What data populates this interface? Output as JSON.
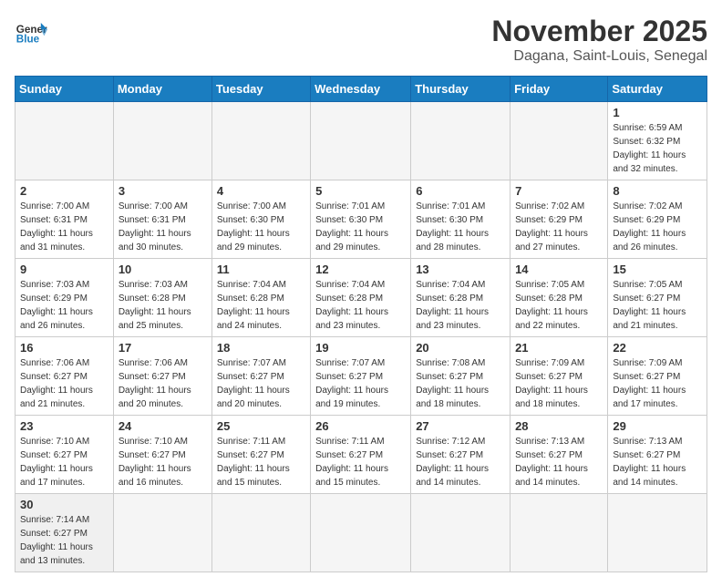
{
  "header": {
    "logo_general": "General",
    "logo_blue": "Blue",
    "month_title": "November 2025",
    "subtitle": "Dagana, Saint-Louis, Senegal"
  },
  "weekdays": [
    "Sunday",
    "Monday",
    "Tuesday",
    "Wednesday",
    "Thursday",
    "Friday",
    "Saturday"
  ],
  "weeks": [
    [
      {
        "day": "",
        "info": ""
      },
      {
        "day": "",
        "info": ""
      },
      {
        "day": "",
        "info": ""
      },
      {
        "day": "",
        "info": ""
      },
      {
        "day": "",
        "info": ""
      },
      {
        "day": "",
        "info": ""
      },
      {
        "day": "1",
        "info": "Sunrise: 6:59 AM\nSunset: 6:32 PM\nDaylight: 11 hours\nand 32 minutes."
      }
    ],
    [
      {
        "day": "2",
        "info": "Sunrise: 7:00 AM\nSunset: 6:31 PM\nDaylight: 11 hours\nand 31 minutes."
      },
      {
        "day": "3",
        "info": "Sunrise: 7:00 AM\nSunset: 6:31 PM\nDaylight: 11 hours\nand 30 minutes."
      },
      {
        "day": "4",
        "info": "Sunrise: 7:00 AM\nSunset: 6:30 PM\nDaylight: 11 hours\nand 29 minutes."
      },
      {
        "day": "5",
        "info": "Sunrise: 7:01 AM\nSunset: 6:30 PM\nDaylight: 11 hours\nand 29 minutes."
      },
      {
        "day": "6",
        "info": "Sunrise: 7:01 AM\nSunset: 6:30 PM\nDaylight: 11 hours\nand 28 minutes."
      },
      {
        "day": "7",
        "info": "Sunrise: 7:02 AM\nSunset: 6:29 PM\nDaylight: 11 hours\nand 27 minutes."
      },
      {
        "day": "8",
        "info": "Sunrise: 7:02 AM\nSunset: 6:29 PM\nDaylight: 11 hours\nand 26 minutes."
      }
    ],
    [
      {
        "day": "9",
        "info": "Sunrise: 7:03 AM\nSunset: 6:29 PM\nDaylight: 11 hours\nand 26 minutes."
      },
      {
        "day": "10",
        "info": "Sunrise: 7:03 AM\nSunset: 6:28 PM\nDaylight: 11 hours\nand 25 minutes."
      },
      {
        "day": "11",
        "info": "Sunrise: 7:04 AM\nSunset: 6:28 PM\nDaylight: 11 hours\nand 24 minutes."
      },
      {
        "day": "12",
        "info": "Sunrise: 7:04 AM\nSunset: 6:28 PM\nDaylight: 11 hours\nand 23 minutes."
      },
      {
        "day": "13",
        "info": "Sunrise: 7:04 AM\nSunset: 6:28 PM\nDaylight: 11 hours\nand 23 minutes."
      },
      {
        "day": "14",
        "info": "Sunrise: 7:05 AM\nSunset: 6:28 PM\nDaylight: 11 hours\nand 22 minutes."
      },
      {
        "day": "15",
        "info": "Sunrise: 7:05 AM\nSunset: 6:27 PM\nDaylight: 11 hours\nand 21 minutes."
      }
    ],
    [
      {
        "day": "16",
        "info": "Sunrise: 7:06 AM\nSunset: 6:27 PM\nDaylight: 11 hours\nand 21 minutes."
      },
      {
        "day": "17",
        "info": "Sunrise: 7:06 AM\nSunset: 6:27 PM\nDaylight: 11 hours\nand 20 minutes."
      },
      {
        "day": "18",
        "info": "Sunrise: 7:07 AM\nSunset: 6:27 PM\nDaylight: 11 hours\nand 20 minutes."
      },
      {
        "day": "19",
        "info": "Sunrise: 7:07 AM\nSunset: 6:27 PM\nDaylight: 11 hours\nand 19 minutes."
      },
      {
        "day": "20",
        "info": "Sunrise: 7:08 AM\nSunset: 6:27 PM\nDaylight: 11 hours\nand 18 minutes."
      },
      {
        "day": "21",
        "info": "Sunrise: 7:09 AM\nSunset: 6:27 PM\nDaylight: 11 hours\nand 18 minutes."
      },
      {
        "day": "22",
        "info": "Sunrise: 7:09 AM\nSunset: 6:27 PM\nDaylight: 11 hours\nand 17 minutes."
      }
    ],
    [
      {
        "day": "23",
        "info": "Sunrise: 7:10 AM\nSunset: 6:27 PM\nDaylight: 11 hours\nand 17 minutes."
      },
      {
        "day": "24",
        "info": "Sunrise: 7:10 AM\nSunset: 6:27 PM\nDaylight: 11 hours\nand 16 minutes."
      },
      {
        "day": "25",
        "info": "Sunrise: 7:11 AM\nSunset: 6:27 PM\nDaylight: 11 hours\nand 15 minutes."
      },
      {
        "day": "26",
        "info": "Sunrise: 7:11 AM\nSunset: 6:27 PM\nDaylight: 11 hours\nand 15 minutes."
      },
      {
        "day": "27",
        "info": "Sunrise: 7:12 AM\nSunset: 6:27 PM\nDaylight: 11 hours\nand 14 minutes."
      },
      {
        "day": "28",
        "info": "Sunrise: 7:13 AM\nSunset: 6:27 PM\nDaylight: 11 hours\nand 14 minutes."
      },
      {
        "day": "29",
        "info": "Sunrise: 7:13 AM\nSunset: 6:27 PM\nDaylight: 11 hours\nand 14 minutes."
      }
    ],
    [
      {
        "day": "30",
        "info": "Sunrise: 7:14 AM\nSunset: 6:27 PM\nDaylight: 11 hours\nand 13 minutes."
      },
      {
        "day": "",
        "info": ""
      },
      {
        "day": "",
        "info": ""
      },
      {
        "day": "",
        "info": ""
      },
      {
        "day": "",
        "info": ""
      },
      {
        "day": "",
        "info": ""
      },
      {
        "day": "",
        "info": ""
      }
    ]
  ]
}
